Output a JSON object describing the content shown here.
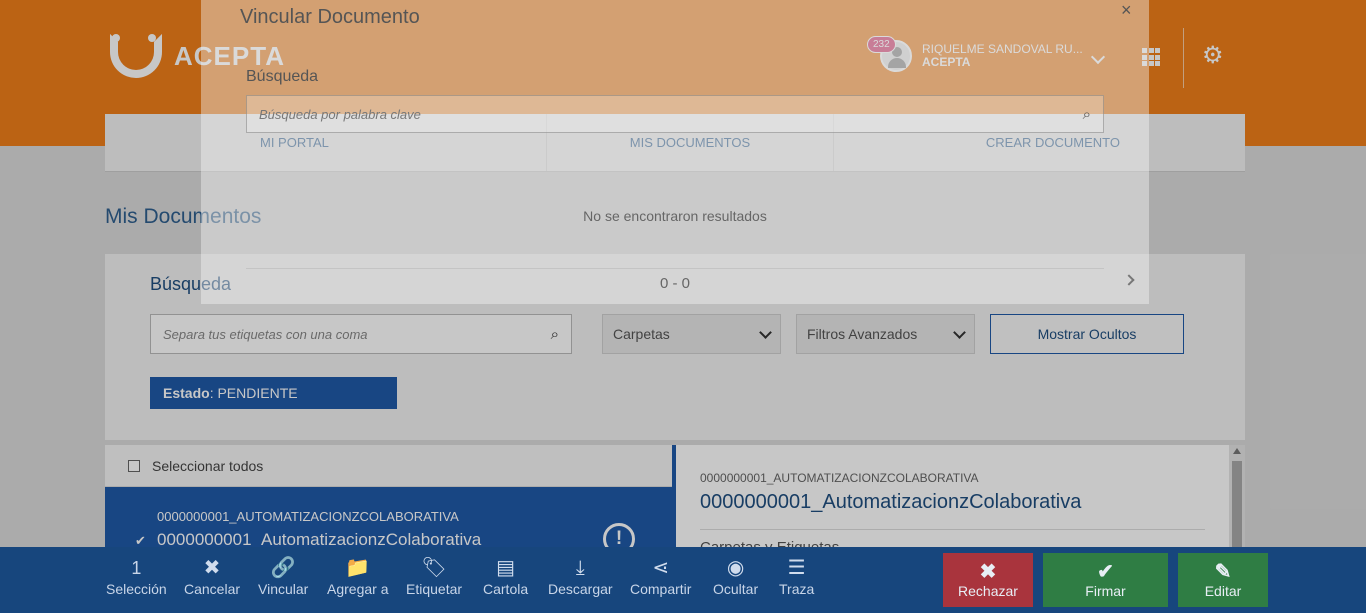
{
  "header": {
    "logo_text": "ACEPTA",
    "notification_count": "232",
    "user_name": "RIQUELME SANDOVAL RU...",
    "user_org": "ACEPTA"
  },
  "nav": {
    "items": [
      "MI PORTAL",
      "MIS DOCUMENTOS",
      "CREAR DOCUMENTO"
    ]
  },
  "page_title": "Mis Documentos",
  "search": {
    "title": "Búsqueda",
    "tags_placeholder": "Separa tus etiquetas con una coma",
    "folders_label": "Carpetas",
    "advanced_label": "Filtros Avanzados",
    "show_hidden_label": "Mostrar Ocultos",
    "estado_key": "Estado",
    "estado_value": ": PENDIENTE"
  },
  "list": {
    "select_all_label": "Seleccionar todos",
    "items": [
      {
        "code": "0000000001_AUTOMATIZACIONZCOLABORATIVA",
        "name": "0000000001_AutomatizacionzColaborativa",
        "checked_mark": "✔"
      }
    ]
  },
  "detail": {
    "code": "0000000001_AUTOMATIZACIONZCOLABORATIVA",
    "name": "0000000001_AutomatizacionzColaborativa",
    "section": "Carpetas y Etiquetas"
  },
  "modal": {
    "title": "Vincular Documento",
    "close": "×",
    "search_label": "Búsqueda",
    "search_placeholder": "Búsqueda por palabra clave",
    "no_results": "No se encontraron resultados",
    "pager": "0 - 0"
  },
  "toolbar": {
    "selection_count": "1",
    "selection_label": "Selección",
    "tools": [
      {
        "label": "Cancelar",
        "icon": "✖"
      },
      {
        "label": "Vincular",
        "icon": "🔗"
      },
      {
        "label": "Agregar a",
        "icon": "📁"
      },
      {
        "label": "Etiquetar",
        "icon": "🏷"
      },
      {
        "label": "Cartola",
        "icon": "▤"
      },
      {
        "label": "Descargar",
        "icon": "⤓"
      },
      {
        "label": "Compartir",
        "icon": "⋖"
      },
      {
        "label": "Ocultar",
        "icon": "◉"
      },
      {
        "label": "Traza",
        "icon": "☰"
      }
    ],
    "actions": [
      {
        "label": "Rechazar",
        "icon": "✖",
        "color": "#a9343d"
      },
      {
        "label": "Firmar",
        "icon": "✔",
        "color": "#2f7d44"
      },
      {
        "label": "Editar",
        "icon": "✎",
        "color": "#2f7d44"
      }
    ]
  },
  "colors": {
    "brand_orange": "#f07f1a",
    "primary_blue": "#1f5aa8",
    "toolbar_blue": "#17467d"
  }
}
